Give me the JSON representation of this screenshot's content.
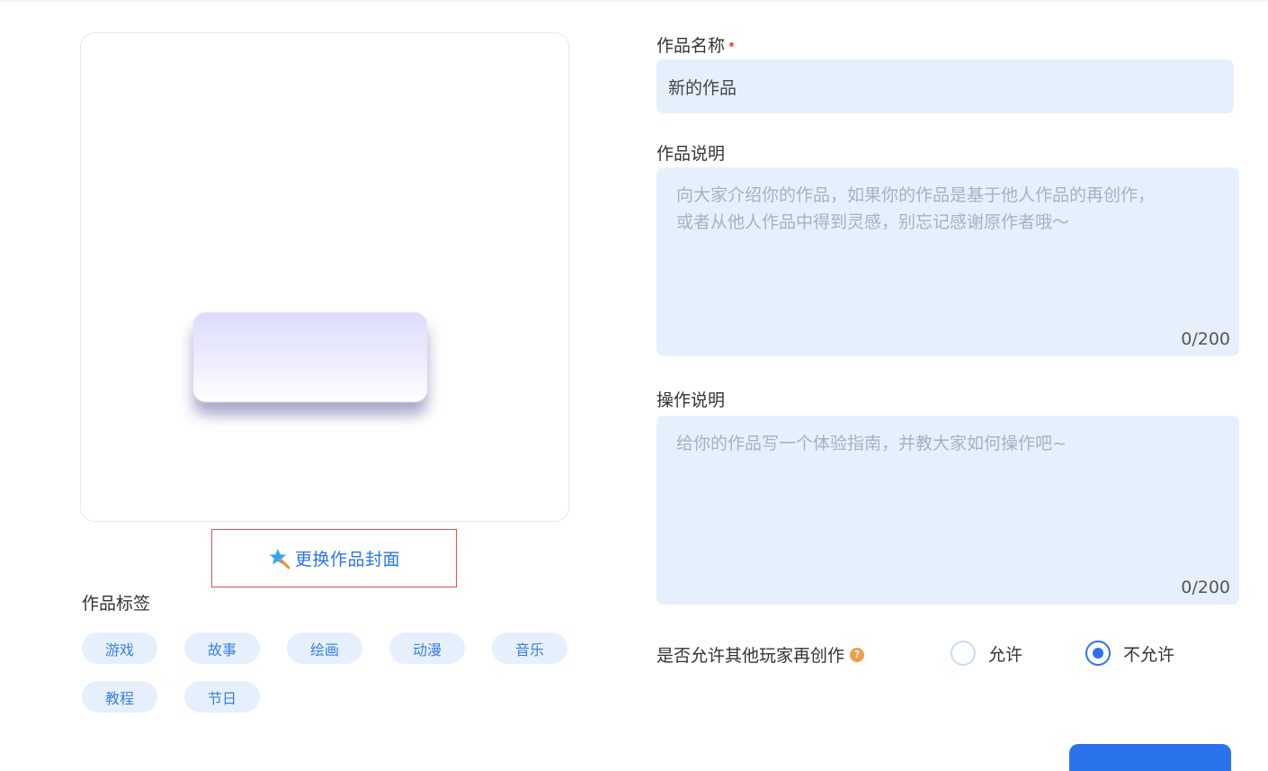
{
  "cover": {
    "change_label": "更换作品封面",
    "wand_icon": "magic-wand-star-icon"
  },
  "tags": {
    "title": "作品标签",
    "items": [
      "游戏",
      "故事",
      "绘画",
      "动漫",
      "音乐",
      "教程",
      "节日"
    ]
  },
  "form": {
    "name": {
      "label": "作品名称",
      "value": "新的作品",
      "required": true
    },
    "description": {
      "label": "作品说明",
      "placeholder_line1": "向大家介绍你的作品，如果你的作品是基于他人作品的再创作，",
      "placeholder_line2": "或者从他人作品中得到灵感，别忘记感谢原作者哦～",
      "counter": "0/200"
    },
    "instructions": {
      "label": "操作说明",
      "placeholder": "给你的作品写一个体验指南，并教大家如何操作吧~",
      "counter": "0/200"
    },
    "remix": {
      "label": "是否允许其他玩家再创作",
      "help_icon": "?",
      "options": [
        "允许",
        "不允许"
      ],
      "selected": "不允许"
    }
  },
  "colors": {
    "accent": "#2a73ec",
    "input_bg": "#e6f0fd",
    "tag_bg": "#e6f0fc",
    "help": "#f39c4a"
  }
}
